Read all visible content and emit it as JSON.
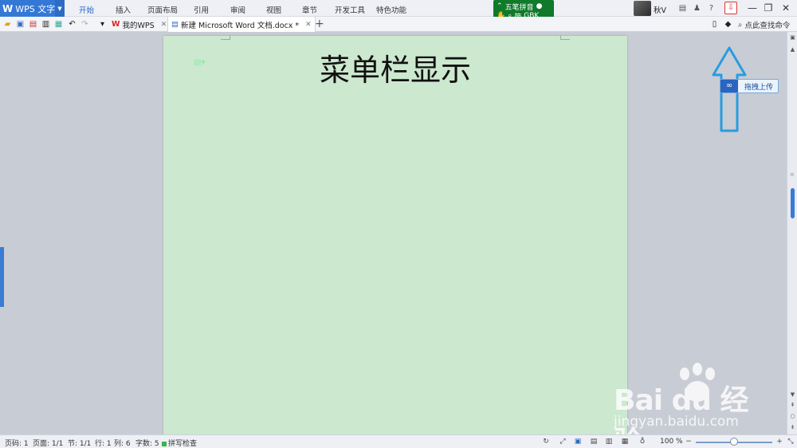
{
  "app": {
    "name": "WPS 文字",
    "logo_letter": "W"
  },
  "menu": {
    "items": [
      {
        "label": "开始",
        "active": true
      },
      {
        "label": "插入"
      },
      {
        "label": "页面布局"
      },
      {
        "label": "引用"
      },
      {
        "label": "审阅"
      },
      {
        "label": "视图"
      },
      {
        "label": "章节"
      },
      {
        "label": "开发工具"
      },
      {
        "label": "特色功能"
      }
    ]
  },
  "ime": {
    "name": "五笔拼音",
    "mode": "简",
    "extra": "GBK"
  },
  "user": {
    "name": "秋V"
  },
  "tabs": [
    {
      "label": "我的WPS"
    },
    {
      "label": "新建 Microsoft Word 文档.docx *"
    }
  ],
  "search": {
    "placeholder": "点此查找命令"
  },
  "document": {
    "title": "菜单栏显示"
  },
  "tooltip": {
    "label": "拖拽上传"
  },
  "statusbar": {
    "page_num": "页码: 1",
    "pages": "页面: 1/1",
    "section": "节: 1/1",
    "row": "行: 1",
    "col": "列: 6",
    "words": "字数: 5",
    "spell": "拼写检查",
    "zoom": "100 %"
  },
  "watermark": {
    "logo": "Bai du 经验",
    "url": "jingyan.baidu.com"
  },
  "colors": {
    "accent": "#3478d6",
    "page": "#cce8cf",
    "arrow": "#2a9be0",
    "ime": "#0f7a2a"
  }
}
